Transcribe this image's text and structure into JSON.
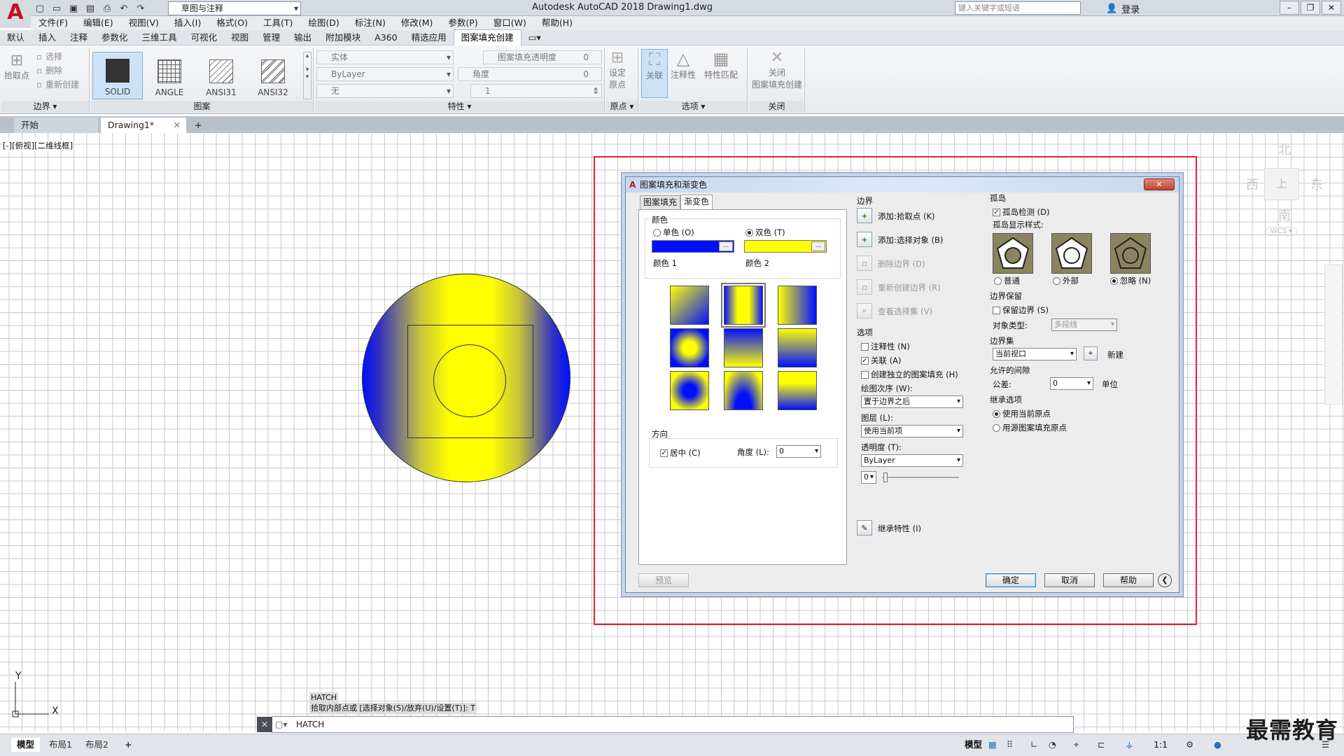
{
  "app": {
    "title": "Autodesk AutoCAD 2018    Drawing1.dwg",
    "logo": "A",
    "workspace": "草图与注释",
    "search_placeholder": "键入关键字或短语",
    "login": "登录"
  },
  "menu": [
    "文件(F)",
    "编辑(E)",
    "视图(V)",
    "插入(I)",
    "格式(O)",
    "工具(T)",
    "绘图(D)",
    "标注(N)",
    "修改(M)",
    "参数(P)",
    "窗口(W)",
    "帮助(H)"
  ],
  "ribbon_tabs": [
    "默认",
    "插入",
    "注释",
    "参数化",
    "三维工具",
    "可视化",
    "视图",
    "管理",
    "输出",
    "附加模块",
    "A360",
    "精选应用",
    "图案填充创建"
  ],
  "ribbon": {
    "boundary": {
      "pick": "拾取点",
      "select": "选择",
      "remove": "删除",
      "recreate": "重新创建",
      "title": "边界"
    },
    "patterns": {
      "items": [
        "SOLID",
        "ANGLE",
        "ANSI31",
        "ANSI32"
      ],
      "title": "图案"
    },
    "props": {
      "type": "实体",
      "color": "ByLayer",
      "bg": "无",
      "transp_label": "图案填充透明度",
      "transp_val": "0",
      "angle_label": "角度",
      "angle_val": "0",
      "scale_val": "1",
      "title": "特性"
    },
    "origin": {
      "label1": "设定",
      "label2": "原点",
      "title": "原点"
    },
    "options": {
      "assoc": "关联",
      "annot": "注释性",
      "match": "特性匹配",
      "title": "选项"
    },
    "close": {
      "label1": "关闭",
      "label2": "图案填充创建",
      "title": "关闭"
    }
  },
  "file_tabs": {
    "start": "开始",
    "drawing": "Drawing1*"
  },
  "viewport_label": "[-][俯视][二维线框]",
  "compass": {
    "n": "北",
    "s": "南",
    "e": "东",
    "w": "西",
    "top": "上",
    "wcs": "WCS"
  },
  "dialog": {
    "title": "图案填充和渐变色",
    "tab_hatch": "图案填充",
    "tab_gradient": "渐变色",
    "color_title": "颜色",
    "one_color": "单色 (O)",
    "two_color": "双色 (T)",
    "color1": "颜色 1",
    "color2": "颜色 2",
    "orientation": "方向",
    "centered": "居中 (C)",
    "angle_label": "角度 (L):",
    "angle_val": "0",
    "preview": "预览",
    "boundary_title": "边界",
    "add_pick": "添加:拾取点 (K)",
    "add_select": "添加:选择对象 (B)",
    "remove": "删除边界 (D)",
    "recreate": "重新创建边界 (R)",
    "view_sel": "查看选择集 (V)",
    "options_title": "选项",
    "annotative": "注释性 (N)",
    "associative": "关联 (A)",
    "separate": "创建独立的图案填充 (H)",
    "draw_order_label": "绘图次序 (W):",
    "draw_order": "置于边界之后",
    "layer_label": "图层 (L):",
    "layer": "使用当前项",
    "transp_label": "透明度 (T):",
    "transp": "ByLayer",
    "transp_val": "0",
    "inherit": "继承特性 (I)",
    "islands_title": "孤岛",
    "island_detect": "孤岛检测 (D)",
    "island_style": "孤岛显示样式:",
    "normal": "普通",
    "outer": "外部",
    "ignore": "忽略 (N)",
    "retain_title": "边界保留",
    "retain": "保留边界 (S)",
    "obj_type_label": "对象类型:",
    "obj_type": "多段线",
    "set_title": "边界集",
    "set_value": "当前视口",
    "new": "新建",
    "gap_title": "允许的间隙",
    "tolerance": "公差:",
    "tol_val": "0",
    "units": "单位",
    "inherit_title": "继承选项",
    "use_current": "使用当前原点",
    "use_source": "用源图案填充原点",
    "ok": "确定",
    "cancel": "取消",
    "help": "帮助"
  },
  "colors": {
    "c1": "#0010ff",
    "c2": "#ffff00"
  },
  "command": {
    "hist1": "HATCH",
    "hist2": "拾取内部点或 [选择对象(S)/放弃(U)/设置(T)]: T",
    "line": "HATCH"
  },
  "layout_tabs": [
    "模型",
    "布局1",
    "布局2"
  ],
  "status": {
    "model": "模型",
    "scale": "1:1"
  },
  "watermark": "最需教育"
}
